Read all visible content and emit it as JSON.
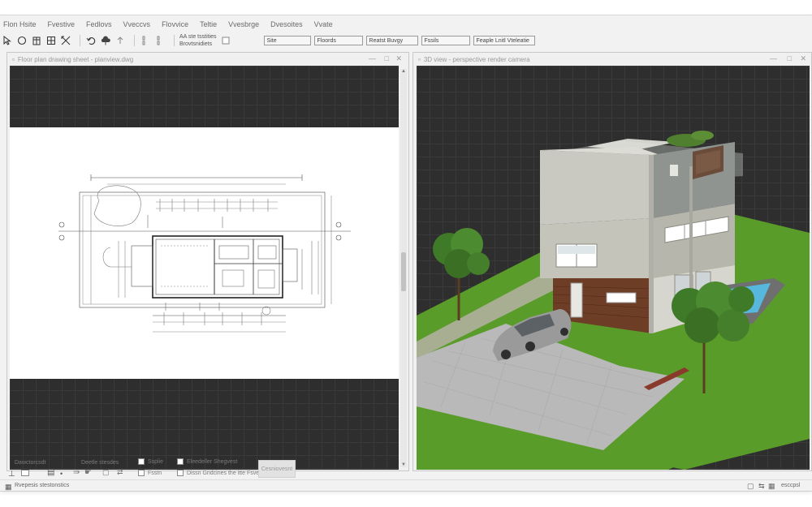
{
  "menu": {
    "items": [
      "Flon Hsite",
      "Fvestive",
      "Fedlovs",
      "Vveccvs",
      "Flovvice",
      "Teltie",
      "Vvesbrge",
      "Dvesoites",
      "Vvate"
    ]
  },
  "toolbar": {
    "text_label_1": "AA ste tsstities",
    "text_label_2": "Brovtsnidiets",
    "dropdowns": [
      "Site",
      "Floords",
      "Reatst Buvgy",
      "Fssils",
      "Feaple Lnitl Vteleatie"
    ],
    "icons": [
      "select-icon",
      "circle-icon",
      "building-icon",
      "grid-icon",
      "resize-icon",
      "undo-icon",
      "cloud-icon",
      "chevron-icon",
      "column-icon",
      "column-icon-2"
    ]
  },
  "left_pane": {
    "title": "Floor plan drawing sheet - planview.dwg"
  },
  "right_pane": {
    "title": "3D view - perspective render camera"
  },
  "bottom": {
    "group_label_1": "Dawctorcsdt",
    "group_label_2": "Deetle stesdes",
    "checkbox_1": "Ssplie",
    "checkbox_2": "Fsstn",
    "checkbox_3": "Eleedeller Shegvest",
    "checkbox_4": "Dissn Gndcines",
    "checkbox_4b": "the itte",
    "checkbox_4c": "Fsveb",
    "button_label": "Cesniovesnt",
    "status_left": "Rvepesis stestonstics",
    "status_right": "esccpsl"
  },
  "colors": {
    "viewport_bg": "#2e2e2e",
    "grass": "#5a9c2a",
    "paving": "#b9b9b9",
    "wall_light": "#c9c9c2",
    "wood": "#6e3d25",
    "pool": "#58b7dc"
  }
}
